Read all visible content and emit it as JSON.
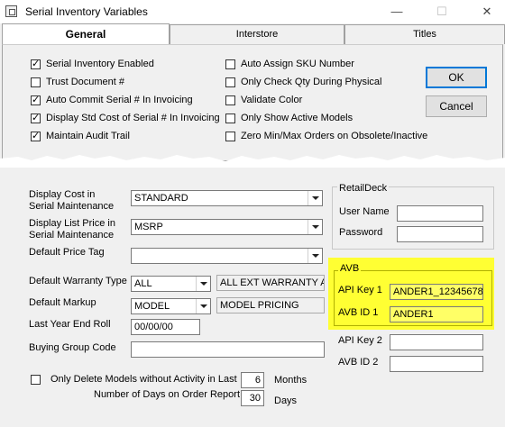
{
  "window": {
    "title": "Serial Inventory Variables"
  },
  "tabs": [
    "General",
    "Interstore",
    "Titles"
  ],
  "buttons": {
    "ok": "OK",
    "cancel": "Cancel"
  },
  "checkboxes_left": [
    {
      "label": "Serial Inventory Enabled",
      "checked": true
    },
    {
      "label": "Trust Document #",
      "checked": false
    },
    {
      "label": "Auto Commit Serial # In Invoicing",
      "checked": true
    },
    {
      "label": "Display Std Cost of Serial # In Invoicing",
      "checked": true
    },
    {
      "label": "Maintain Audit Trail",
      "checked": true
    }
  ],
  "checkboxes_right": [
    {
      "label": "Auto Assign SKU Number",
      "checked": false
    },
    {
      "label": "Only Check Qty During Physical",
      "checked": false
    },
    {
      "label": "Validate Color",
      "checked": false
    },
    {
      "label": "Only Show Active Models",
      "checked": false
    },
    {
      "label": "Zero Min/Max Orders on Obsolete/Inactive",
      "checked": false
    }
  ],
  "fields": {
    "display_cost_label": "Display Cost in",
    "display_cost_label2": "Serial Maintenance",
    "display_cost_value": "STANDARD",
    "display_list_label": "Display List Price in",
    "display_list_label2": "Serial Maintenance",
    "display_list_value": "MSRP",
    "default_price_tag_label": "Default Price Tag",
    "default_price_tag_value": "",
    "default_warranty_label": "Default Warranty Type",
    "default_warranty_value": "ALL",
    "default_warranty_desc": "ALL EXT WARRANTY AND",
    "default_markup_label": "Default Markup",
    "default_markup_value": "MODEL",
    "default_markup_desc": "MODEL PRICING",
    "last_year_end_label": "Last Year End Roll",
    "last_year_end_value": "00/00/00",
    "buying_group_label": "Buying Group Code",
    "buying_group_value": "",
    "only_delete_label": "Only Delete Models without Activity in Last",
    "only_delete_value": "6",
    "months_label": "Months",
    "days_on_order_label": "Number of Days on Order Report",
    "days_on_order_value": "30",
    "days_label": "Days"
  },
  "retaildeck": {
    "title": "RetailDeck",
    "user_name_label": "User Name",
    "user_name_value": "",
    "password_label": "Password",
    "password_value": ""
  },
  "avb": {
    "title": "AVB",
    "api_key1_label": "API Key 1",
    "api_key1_value": "ANDER1_12345678",
    "avb_id1_label": "AVB ID 1",
    "avb_id1_value": "ANDER1",
    "api_key2_label": "API Key 2",
    "api_key2_value": "",
    "avb_id2_label": "AVB ID 2",
    "avb_id2_value": ""
  },
  "colors": {
    "highlight": "#ffff33",
    "focus_border": "#0078d7"
  }
}
